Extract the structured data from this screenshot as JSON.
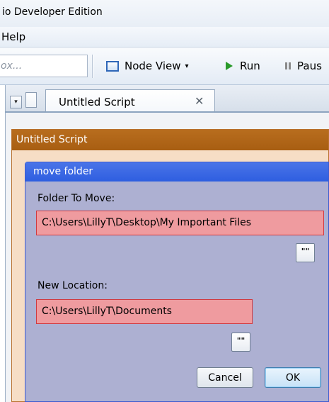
{
  "window": {
    "title": "io Developer Edition"
  },
  "menubar": {
    "items": [
      "Help"
    ]
  },
  "toolbar": {
    "search_placeholder": "ox...",
    "node_view_label": "Node View",
    "node_view_caret": "▾",
    "run_label": "Run",
    "pause_label": "Paus"
  },
  "tabs": {
    "active_tab": "Untitled Script",
    "close_glyph": "✕",
    "dropdown_glyph": "▾"
  },
  "script_window": {
    "title": "Untitled Script"
  },
  "node": {
    "title": "move folder",
    "folder_label": "Folder To Move:",
    "folder_value": "C:\\Users\\LillyT\\Desktop\\My Important Files",
    "location_label": "New Location:",
    "location_value": "C:\\Users\\LillyT\\Documents",
    "quote_glyph": "\"\"",
    "cancel_label": "Cancel",
    "ok_label": "OK"
  },
  "colors": {
    "script_title_bar": "#a85e12",
    "node_title_bar": "#2e5ee0",
    "node_body": "#adb0d2",
    "field_error_fill": "#ef9b9f",
    "run_icon": "#2a9a2a"
  }
}
